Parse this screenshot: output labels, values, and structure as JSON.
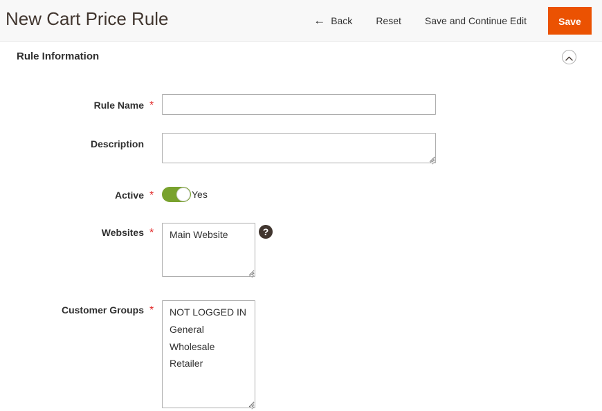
{
  "header": {
    "title": "New Cart Price Rule",
    "actions": [
      {
        "id": "back",
        "label": "Back",
        "icon": "arrow-left-icon"
      },
      {
        "id": "reset",
        "label": "Reset"
      },
      {
        "id": "save_continue",
        "label": "Save and Continue Edit"
      }
    ],
    "save_label": "Save",
    "save_color": "#eb5202"
  },
  "section": {
    "title": "Rule Information",
    "collapse_icon": "chevron-up-icon"
  },
  "form": {
    "rule_name": {
      "label": "Rule Name",
      "required": true,
      "value": "",
      "placeholder": ""
    },
    "description": {
      "label": "Description",
      "required": false,
      "value": "",
      "placeholder": ""
    },
    "active": {
      "label": "Active",
      "required": true,
      "state_label": "Yes",
      "on": true,
      "on_color": "#79a22e"
    },
    "websites": {
      "label": "Websites",
      "required": true,
      "options": [
        "Main Website"
      ],
      "selected": [],
      "help_icon": "question-mark-icon"
    },
    "customer_groups": {
      "label": "Customer Groups",
      "required": true,
      "options": [
        "NOT LOGGED IN",
        "General",
        "Wholesale",
        "Retailer"
      ],
      "selected": []
    }
  },
  "required_marker": "*"
}
